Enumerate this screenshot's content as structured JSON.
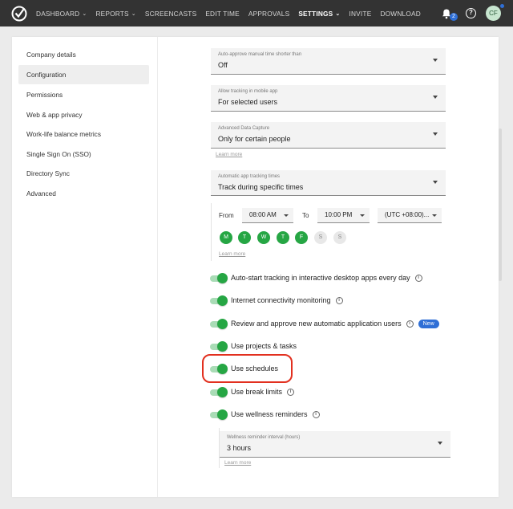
{
  "nav": {
    "items": [
      {
        "label": "DASHBOARD",
        "has_menu": true
      },
      {
        "label": "REPORTS",
        "has_menu": true
      },
      {
        "label": "SCREENCASTS",
        "has_menu": false
      },
      {
        "label": "EDIT TIME",
        "has_menu": false
      },
      {
        "label": "APPROVALS",
        "has_menu": false
      },
      {
        "label": "SETTINGS",
        "has_menu": true,
        "active": true
      },
      {
        "label": "INVITE",
        "has_menu": false
      },
      {
        "label": "DOWNLOAD",
        "has_menu": false
      }
    ],
    "notification_count": "2",
    "help_label": "?",
    "avatar_initials": "CF"
  },
  "sidebar": {
    "items": [
      {
        "label": "Company details"
      },
      {
        "label": "Configuration",
        "active": true
      },
      {
        "label": "Permissions"
      },
      {
        "label": "Web & app privacy"
      },
      {
        "label": "Work-life balance metrics"
      },
      {
        "label": "Single Sign On (SSO)"
      },
      {
        "label": "Directory Sync"
      },
      {
        "label": "Advanced"
      }
    ]
  },
  "settings": {
    "auto_approve": {
      "label": "Auto-approve manual time shorter than",
      "value": "Off"
    },
    "mobile_tracking": {
      "label": "Allow tracking in mobile app",
      "value": "For selected users"
    },
    "advanced_capture": {
      "label": "Advanced Data Capture",
      "value": "Only for certain people",
      "learn_more": "Learn more"
    },
    "app_tracking": {
      "label": "Automatic app tracking times",
      "value": "Track during specific times"
    },
    "schedule": {
      "from_label": "From",
      "from_value": "08:00 AM",
      "to_label": "To",
      "to_value": "10:00 PM",
      "timezone": "(UTC +08:00)...",
      "days": [
        {
          "label": "M",
          "on": true
        },
        {
          "label": "T",
          "on": true
        },
        {
          "label": "W",
          "on": true
        },
        {
          "label": "T",
          "on": true
        },
        {
          "label": "F",
          "on": true
        },
        {
          "label": "S",
          "on": false
        },
        {
          "label": "S",
          "on": false
        }
      ],
      "learn_more": "Learn more"
    },
    "toggles": [
      {
        "label": "Auto-start tracking in interactive desktop apps every day",
        "info": true,
        "on": true
      },
      {
        "label": "Internet connectivity monitoring",
        "info": true,
        "on": true
      },
      {
        "label": "Review and approve new automatic application users",
        "info": true,
        "badge": "New",
        "on": true
      },
      {
        "label": "Use projects & tasks",
        "info": false,
        "on": true
      },
      {
        "label": "Use schedules",
        "info": false,
        "on": true
      },
      {
        "label": "Use break limits",
        "info": true,
        "on": true
      },
      {
        "label": "Use wellness reminders",
        "info": true,
        "on": true
      }
    ],
    "wellness": {
      "label": "Wellness reminder interval (hours)",
      "value": "3 hours",
      "learn_more": "Learn more"
    },
    "info_glyph": "i"
  },
  "colors": {
    "topbar": "#333333",
    "accent_green": "#26a644",
    "badge_blue": "#2f6fd6",
    "highlight_red": "#e2301f"
  },
  "icons": [
    "app-logo-icon",
    "bell-icon",
    "help-icon",
    "chevron-down-icon",
    "caret-down-icon",
    "info-icon"
  ]
}
